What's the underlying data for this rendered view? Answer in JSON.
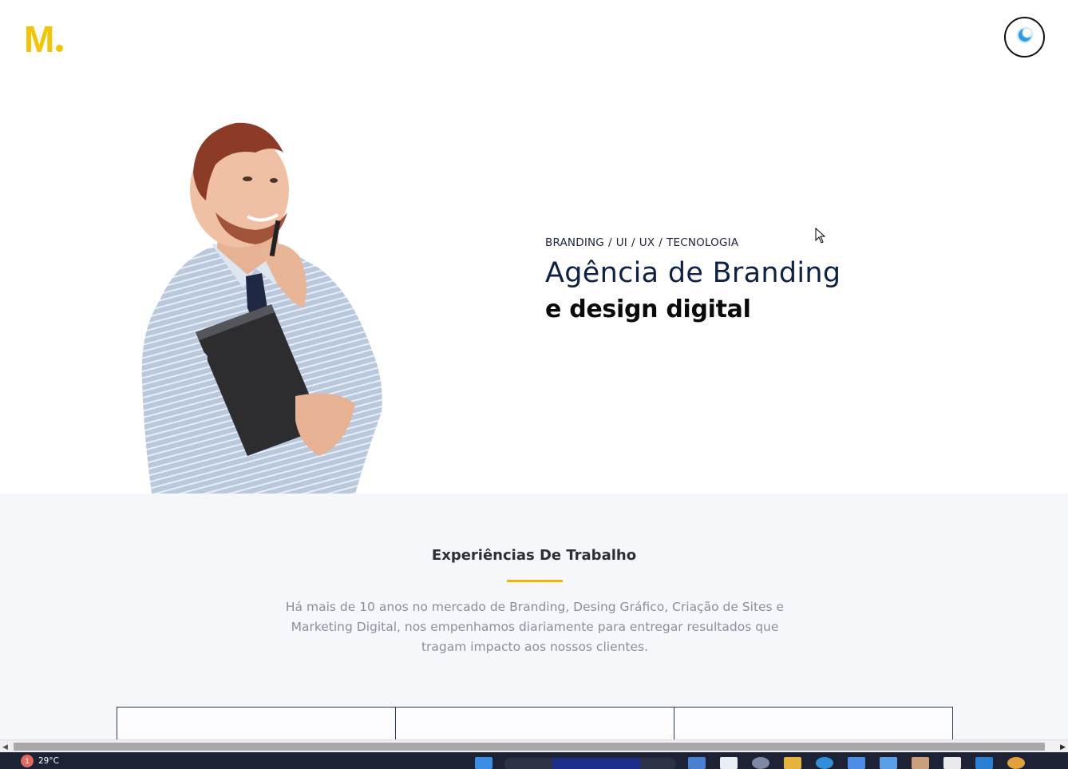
{
  "header": {
    "logo_letter": "M",
    "theme_toggle_icon": "moon-icon"
  },
  "hero": {
    "tags": [
      "BRANDING",
      "/",
      "UI",
      "/",
      "UX",
      "/",
      "TECNOLOGIA"
    ],
    "title": "Agência de Branding",
    "subtitle": "e design digital"
  },
  "experience": {
    "title": "Experiências De Trabalho",
    "description": "Há mais de 10 anos no mercado de Branding, Desing Gráfico, Criação de Sites e Marketing Digital, nos empenhamos diariamente para entregar resultados que tragam impacto aos nossos clientes."
  },
  "taskbar": {
    "notification_count": "1",
    "temperature": "29°C"
  },
  "colors": {
    "brand_yellow": "#f5c400",
    "accent_underline": "#f5b400",
    "title_navy": "#0f2245",
    "section_bg": "#f5f7fb"
  }
}
